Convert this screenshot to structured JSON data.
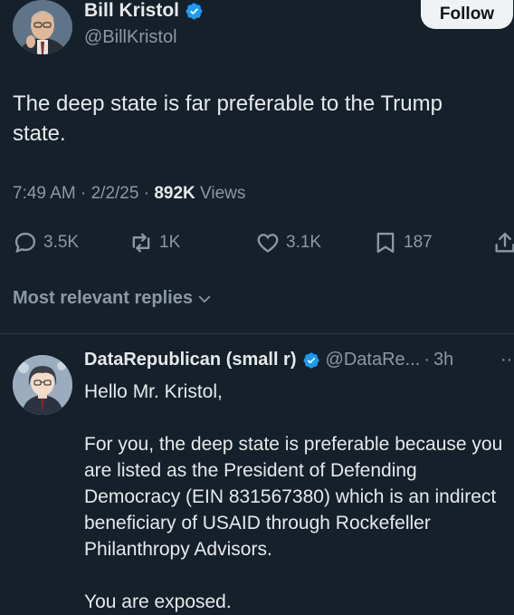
{
  "author": {
    "display_name": "Bill Kristol",
    "handle": "@BillKristol",
    "verified_icon": "verified-badge-icon"
  },
  "follow_button": {
    "label": "Follow"
  },
  "tweet": {
    "text": "The deep state is far preferable to the Trump state.",
    "time_date": "7:49 AM · 2/2/25 · ",
    "views_count": "892K",
    "views_label": " Views"
  },
  "actions": {
    "replies": "3.5K",
    "reposts": "1K",
    "likes": "3.1K",
    "bookmarks": "187"
  },
  "replies_filter": {
    "label": "Most relevant replies"
  },
  "reply": {
    "display_name": "DataRepublican (small r)",
    "handle": "@DataRe...",
    "separator": "·",
    "time": "3h",
    "more": "··",
    "body": [
      "Hello Mr. Kristol,",
      "",
      "For you, the deep state is preferable because you are listed as the President of Defending Democracy (EIN 831567380) which is an indirect beneficiary of USAID through Rockefeller Philanthropy Advisors.",
      "",
      "You are exposed."
    ]
  },
  "colors": {
    "background": "#15202b",
    "text": "#e7e9ea",
    "secondary": "#8b98a5",
    "verified": "#1d9bf0"
  }
}
